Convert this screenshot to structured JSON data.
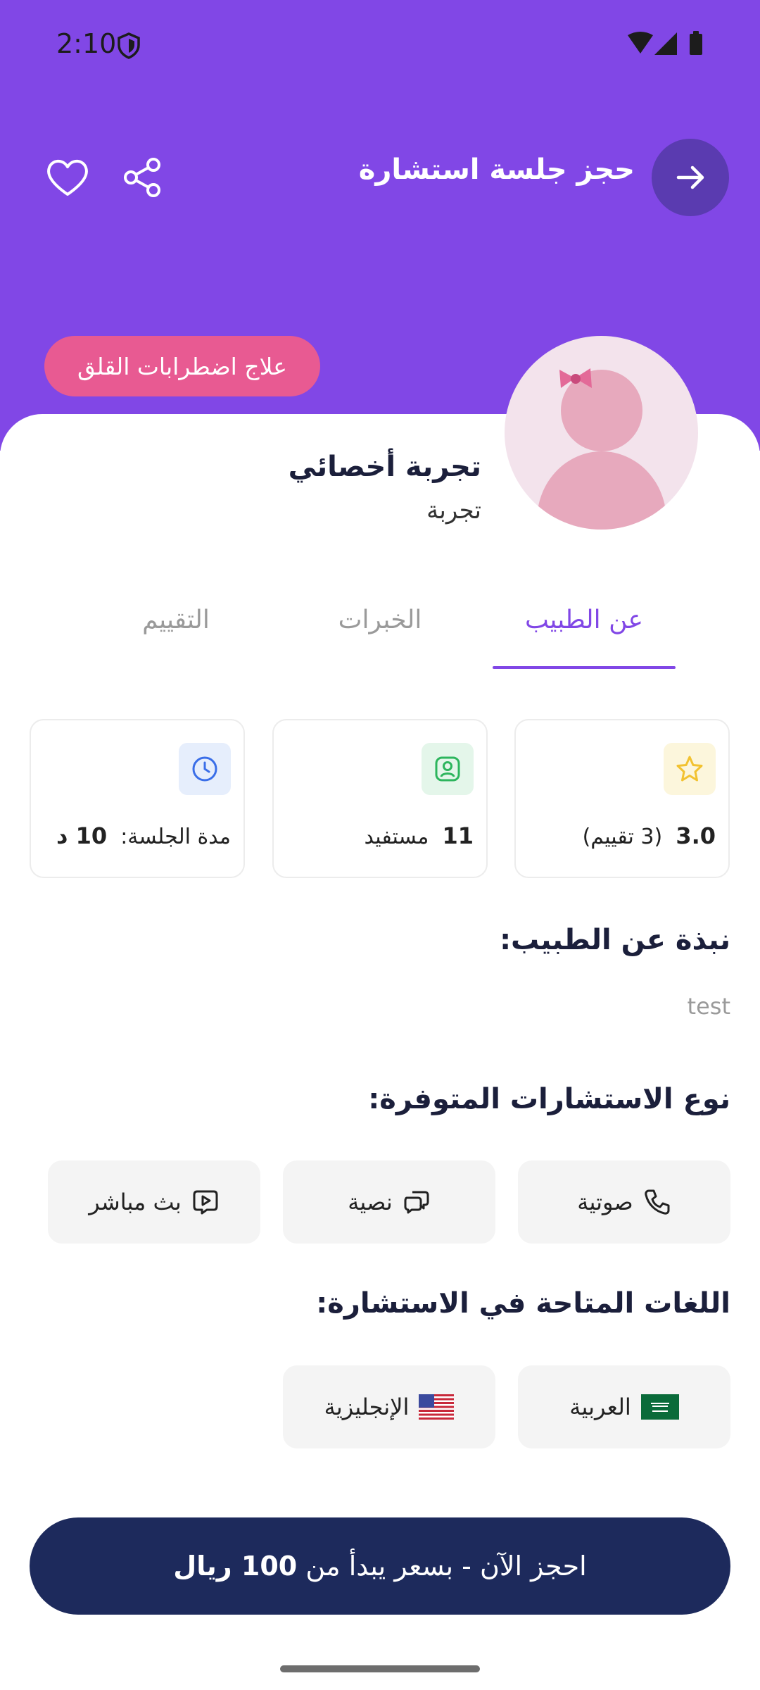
{
  "status_bar": {
    "time": "2:10"
  },
  "header": {
    "title": "حجز جلسة استشارة",
    "back_icon": "arrow-right-icon",
    "share_icon": "share-icon",
    "favorite_icon": "heart-icon"
  },
  "doctor": {
    "specialty_badge": "علاج اضطرابات القلق",
    "name": "تجربة أخصائي",
    "subtitle": "تجربة"
  },
  "tabs": [
    {
      "label": "عن الطبيب",
      "active": true
    },
    {
      "label": "الخبرات",
      "active": false
    },
    {
      "label": "التقييم",
      "active": false
    }
  ],
  "stats": {
    "rating": {
      "value": "3.0",
      "note": "(3 تقييم)",
      "icon": "star-icon",
      "color": "#f2c230"
    },
    "beneficiaries": {
      "value": "11",
      "label": "مستفيد",
      "icon": "user-icon",
      "color": "#2db55d"
    },
    "duration": {
      "label": "مدة الجلسة:",
      "value": "10 د",
      "icon": "clock-icon",
      "color": "#3a6ee8"
    }
  },
  "about": {
    "title": "نبذة عن الطبيب:",
    "text": "test"
  },
  "consultation_types": {
    "title": "نوع الاستشارات المتوفرة:",
    "items": [
      {
        "label": "صوتية",
        "icon": "phone-icon"
      },
      {
        "label": "نصية",
        "icon": "chat-icon"
      },
      {
        "label": "بث مباشر",
        "icon": "live-video-icon"
      }
    ]
  },
  "languages": {
    "title": "اللغات المتاحة في الاستشارة:",
    "items": [
      {
        "label": "العربية",
        "icon": "saudi-flag-icon"
      },
      {
        "label": "الإنجليزية",
        "icon": "us-flag-icon"
      }
    ]
  },
  "booking": {
    "label_prefix": "احجز الآن - بسعر يبدأ من",
    "price": "100 ريال"
  },
  "colors": {
    "header_bg": "#8147e6",
    "accent": "#8147e6",
    "badge": "#e85a92",
    "button_bg": "#1d2a5c"
  }
}
